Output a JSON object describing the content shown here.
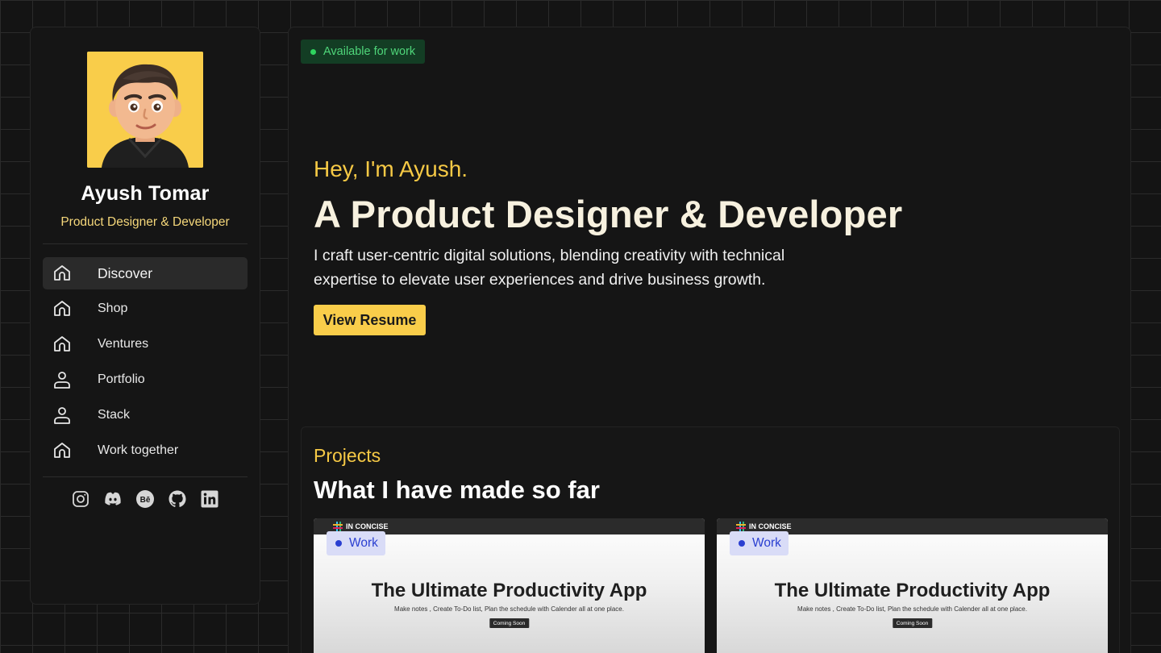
{
  "profile": {
    "name": "Ayush Tomar",
    "role": "Product Designer & Developer"
  },
  "nav": {
    "items": [
      {
        "label": "Discover",
        "icon": "home-icon"
      },
      {
        "label": "Shop",
        "icon": "home-icon"
      },
      {
        "label": "Ventures",
        "icon": "home-icon"
      },
      {
        "label": "Portfolio",
        "icon": "user-icon"
      },
      {
        "label": "Stack",
        "icon": "user-icon"
      },
      {
        "label": "Work together",
        "icon": "home-icon"
      }
    ]
  },
  "socials": [
    "instagram-icon",
    "discord-icon",
    "behance-icon",
    "github-icon",
    "linkedin-icon"
  ],
  "badge": {
    "text": "Available for work"
  },
  "hero": {
    "greeting": "Hey, I'm Ayush.",
    "title": "A Product Designer & Developer",
    "description": "I craft user-centric digital solutions, blending creativity with technical expertise to elevate user experiences and drive business growth.",
    "button": "View Resume"
  },
  "projects": {
    "kicker": "Projects",
    "title": "What I have made so far",
    "cards": [
      {
        "brand": "IN CONCISE",
        "tag": "Work",
        "headline": "The Ultimate Productivity App",
        "sub": "Make notes , Create To-Do list, Plan the schedule with Calender all at one place.",
        "cta": "Coming Soon"
      },
      {
        "brand": "IN CONCISE",
        "tag": "Work",
        "headline": "The Ultimate Productivity App",
        "sub": "Make notes , Create To-Do list, Plan the schedule with Calender all at one place.",
        "cta": "Coming Soon"
      }
    ]
  },
  "colors": {
    "accent": "#f9cd4a",
    "background": "#141414",
    "available_green": "#2fd45f",
    "tag_blue": "#2a3fd1"
  }
}
